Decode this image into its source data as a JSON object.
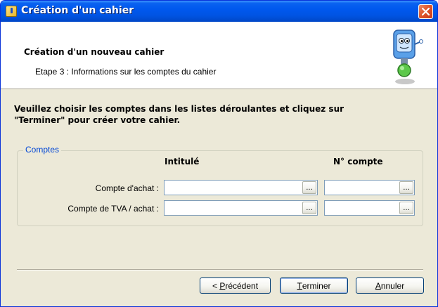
{
  "window": {
    "title": "Création d'un cahier",
    "close_label": "×"
  },
  "header": {
    "title": "Création d'un nouveau cahier",
    "subtitle": "Etape 3 : Informations sur les comptes du cahier"
  },
  "instruction": {
    "line1": "Veuillez choisir les comptes dans les listes déroulantes et cliquez sur",
    "line2": "\"Terminer\" pour créer votre cahier."
  },
  "group": {
    "legend": "Comptes",
    "columns": {
      "label": "Intitulé",
      "number": "N° compte"
    },
    "rows": [
      {
        "label": "Compte d'achat :",
        "label_value": "",
        "number_value": "",
        "button": "..."
      },
      {
        "label": "Compte de TVA / achat :",
        "label_value": "",
        "number_value": "",
        "button": "..."
      }
    ]
  },
  "buttons": {
    "previous": {
      "pre": "< ",
      "mnemonic": "P",
      "rest": "récédent"
    },
    "finish": {
      "pre": "",
      "mnemonic": "T",
      "rest": "erminer"
    },
    "cancel": {
      "pre": "",
      "mnemonic": "A",
      "rest": "nnuler"
    }
  },
  "colors": {
    "titlebar": "#0054e3",
    "dialog_bg": "#ece9d8",
    "legend": "#0046d5",
    "close": "#e0562b"
  }
}
